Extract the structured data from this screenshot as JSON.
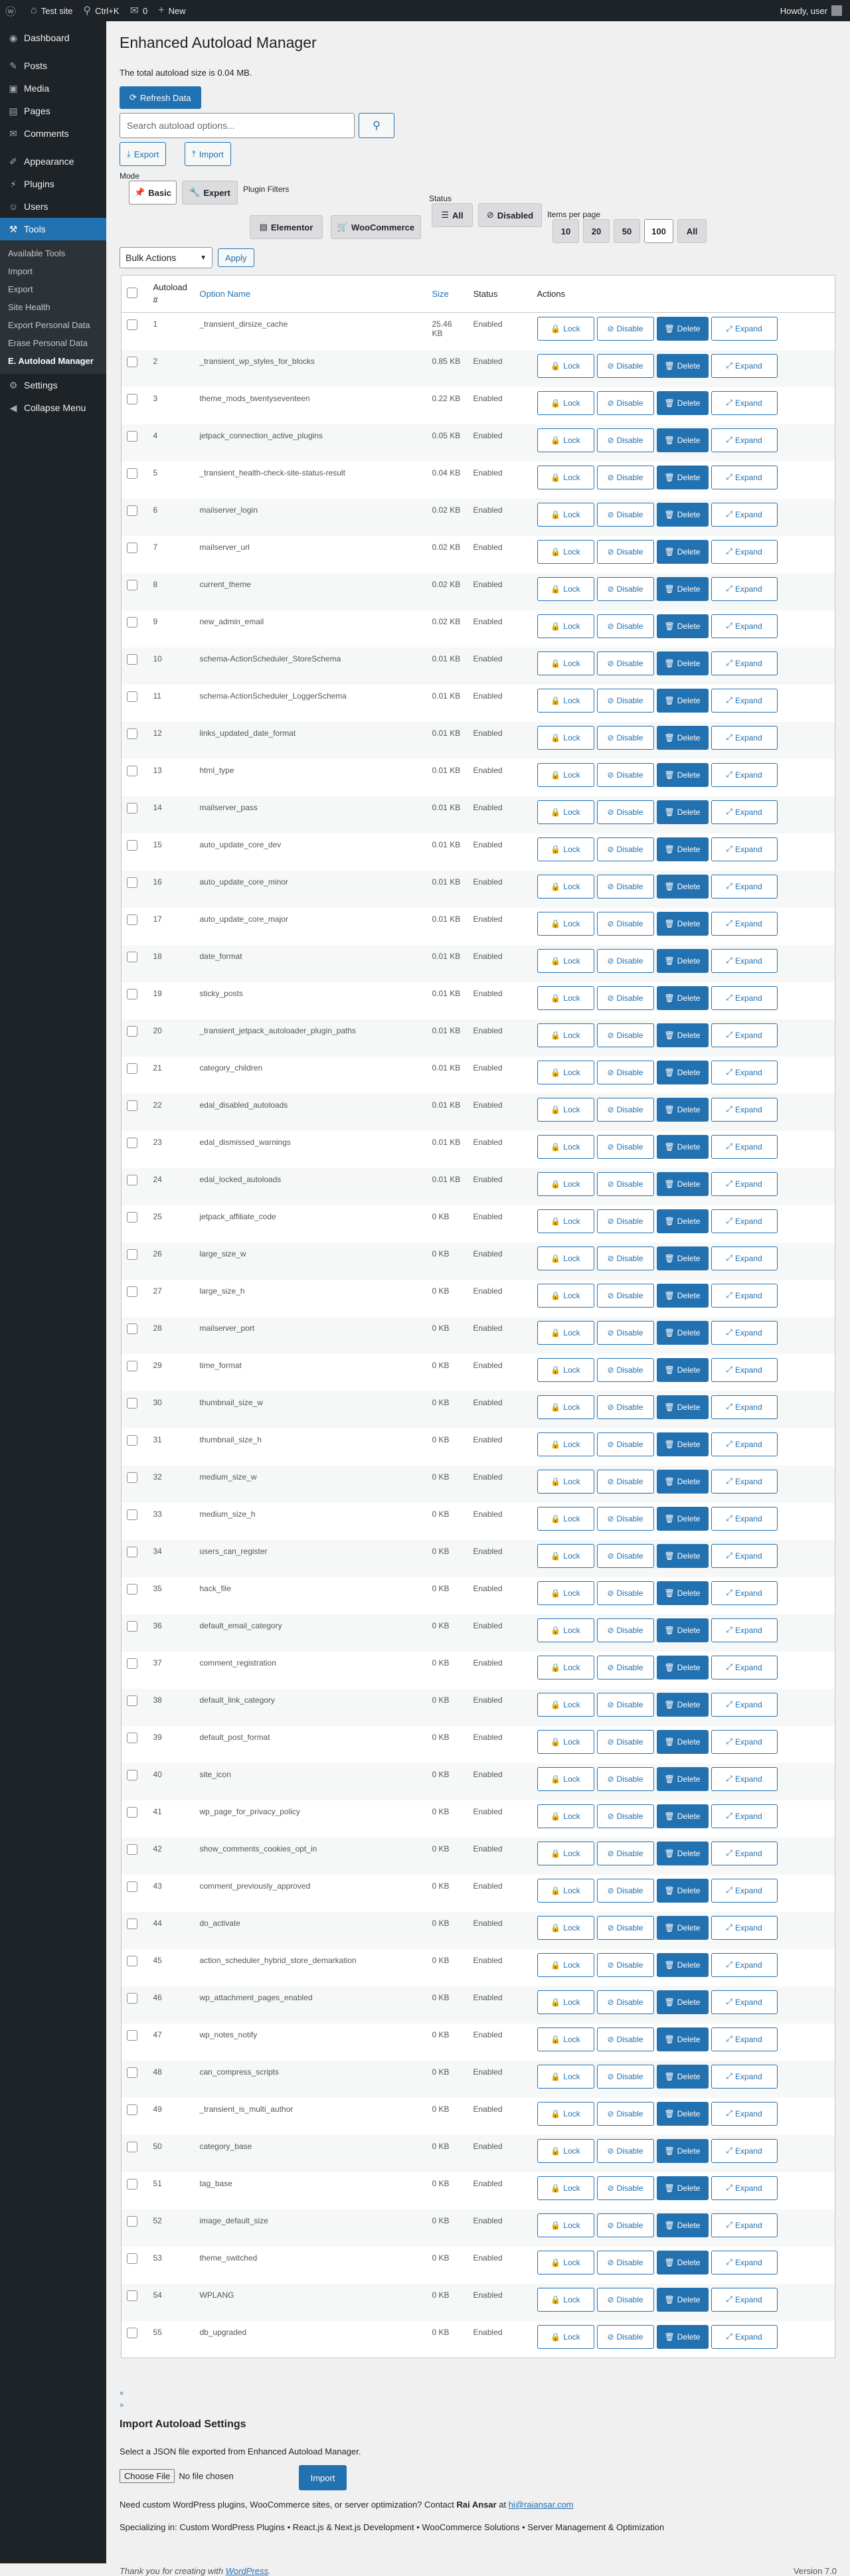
{
  "adminbar": {
    "site": "Test site",
    "search": "Ctrl+K",
    "comments": "0",
    "new": "New",
    "howdy": "Howdy, user"
  },
  "sidebar": {
    "items": [
      {
        "label": "Dashboard",
        "icon": "dashboard-icon"
      },
      {
        "label": "Posts",
        "icon": "pin-icon"
      },
      {
        "label": "Media",
        "icon": "media-icon"
      },
      {
        "label": "Pages",
        "icon": "page-icon"
      },
      {
        "label": "Comments",
        "icon": "comment-icon"
      },
      {
        "label": "Appearance",
        "icon": "brush-icon"
      },
      {
        "label": "Plugins",
        "icon": "plugin-icon"
      },
      {
        "label": "Users",
        "icon": "user-icon"
      },
      {
        "label": "Tools",
        "icon": "wrench-icon"
      }
    ],
    "submenu": [
      "Available Tools",
      "Import",
      "Export",
      "Site Health",
      "Export Personal Data",
      "Erase Personal Data",
      "E. Autoload Manager"
    ],
    "settings": "Settings",
    "collapse": "Collapse Menu"
  },
  "page": {
    "title": "Enhanced Autoload Manager",
    "total": "The total autoload size is 0.04 MB.",
    "refresh": "Refresh Data",
    "search_placeholder": "Search autoload options...",
    "export": "Export",
    "import": "Import"
  },
  "filters": {
    "mode_label": "Mode",
    "mode": [
      "Basic",
      "Expert"
    ],
    "plugin_label": "Plugin Filters",
    "plugins": [
      "Elementor",
      "WooCommerce"
    ],
    "status_label": "Status",
    "status": [
      "All",
      "Disabled"
    ],
    "perpage_label": "Items per page",
    "perpage": [
      "10",
      "20",
      "50",
      "100",
      "All"
    ]
  },
  "bulk": {
    "label": "Bulk Actions",
    "apply": "Apply"
  },
  "table": {
    "headers": {
      "num": "Autoload #",
      "name": "Option Name",
      "size": "Size",
      "status": "Status",
      "actions": "Actions"
    },
    "action_labels": {
      "lock": "Lock",
      "disable": "Disable",
      "delete": "Delete",
      "expand": "Expand"
    },
    "rows": [
      {
        "num": "1",
        "name": "_transient_dirsize_cache",
        "size": "25.46 KB",
        "status": "Enabled"
      },
      {
        "num": "2",
        "name": "_transient_wp_styles_for_blocks",
        "size": "0.85 KB",
        "status": "Enabled"
      },
      {
        "num": "3",
        "name": "theme_mods_twentyseventeen",
        "size": "0.22 KB",
        "status": "Enabled"
      },
      {
        "num": "4",
        "name": "jetpack_connection_active_plugins",
        "size": "0.05 KB",
        "status": "Enabled"
      },
      {
        "num": "5",
        "name": "_transient_health-check-site-status-result",
        "size": "0.04 KB",
        "status": "Enabled"
      },
      {
        "num": "6",
        "name": "mailserver_login",
        "size": "0.02 KB",
        "status": "Enabled"
      },
      {
        "num": "7",
        "name": "mailserver_url",
        "size": "0.02 KB",
        "status": "Enabled"
      },
      {
        "num": "8",
        "name": "current_theme",
        "size": "0.02 KB",
        "status": "Enabled"
      },
      {
        "num": "9",
        "name": "new_admin_email",
        "size": "0.02 KB",
        "status": "Enabled"
      },
      {
        "num": "10",
        "name": "schema-ActionScheduler_StoreSchema",
        "size": "0.01 KB",
        "status": "Enabled"
      },
      {
        "num": "11",
        "name": "schema-ActionScheduler_LoggerSchema",
        "size": "0.01 KB",
        "status": "Enabled"
      },
      {
        "num": "12",
        "name": "links_updated_date_format",
        "size": "0.01 KB",
        "status": "Enabled"
      },
      {
        "num": "13",
        "name": "html_type",
        "size": "0.01 KB",
        "status": "Enabled"
      },
      {
        "num": "14",
        "name": "mailserver_pass",
        "size": "0.01 KB",
        "status": "Enabled"
      },
      {
        "num": "15",
        "name": "auto_update_core_dev",
        "size": "0.01 KB",
        "status": "Enabled"
      },
      {
        "num": "16",
        "name": "auto_update_core_minor",
        "size": "0.01 KB",
        "status": "Enabled"
      },
      {
        "num": "17",
        "name": "auto_update_core_major",
        "size": "0.01 KB",
        "status": "Enabled"
      },
      {
        "num": "18",
        "name": "date_format",
        "size": "0.01 KB",
        "status": "Enabled"
      },
      {
        "num": "19",
        "name": "sticky_posts",
        "size": "0.01 KB",
        "status": "Enabled"
      },
      {
        "num": "20",
        "name": "_transient_jetpack_autoloader_plugin_paths",
        "size": "0.01 KB",
        "status": "Enabled"
      },
      {
        "num": "21",
        "name": "category_children",
        "size": "0.01 KB",
        "status": "Enabled"
      },
      {
        "num": "22",
        "name": "edal_disabled_autoloads",
        "size": "0.01 KB",
        "status": "Enabled"
      },
      {
        "num": "23",
        "name": "edal_dismissed_warnings",
        "size": "0.01 KB",
        "status": "Enabled"
      },
      {
        "num": "24",
        "name": "edal_locked_autoloads",
        "size": "0.01 KB",
        "status": "Enabled"
      },
      {
        "num": "25",
        "name": "jetpack_affiliate_code",
        "size": "0 KB",
        "status": "Enabled"
      },
      {
        "num": "26",
        "name": "large_size_w",
        "size": "0 KB",
        "status": "Enabled"
      },
      {
        "num": "27",
        "name": "large_size_h",
        "size": "0 KB",
        "status": "Enabled"
      },
      {
        "num": "28",
        "name": "mailserver_port",
        "size": "0 KB",
        "status": "Enabled"
      },
      {
        "num": "29",
        "name": "time_format",
        "size": "0 KB",
        "status": "Enabled"
      },
      {
        "num": "30",
        "name": "thumbnail_size_w",
        "size": "0 KB",
        "status": "Enabled"
      },
      {
        "num": "31",
        "name": "thumbnail_size_h",
        "size": "0 KB",
        "status": "Enabled"
      },
      {
        "num": "32",
        "name": "medium_size_w",
        "size": "0 KB",
        "status": "Enabled"
      },
      {
        "num": "33",
        "name": "medium_size_h",
        "size": "0 KB",
        "status": "Enabled"
      },
      {
        "num": "34",
        "name": "users_can_register",
        "size": "0 KB",
        "status": "Enabled"
      },
      {
        "num": "35",
        "name": "hack_file",
        "size": "0 KB",
        "status": "Enabled"
      },
      {
        "num": "36",
        "name": "default_email_category",
        "size": "0 KB",
        "status": "Enabled"
      },
      {
        "num": "37",
        "name": "comment_registration",
        "size": "0 KB",
        "status": "Enabled"
      },
      {
        "num": "38",
        "name": "default_link_category",
        "size": "0 KB",
        "status": "Enabled"
      },
      {
        "num": "39",
        "name": "default_post_format",
        "size": "0 KB",
        "status": "Enabled"
      },
      {
        "num": "40",
        "name": "site_icon",
        "size": "0 KB",
        "status": "Enabled"
      },
      {
        "num": "41",
        "name": "wp_page_for_privacy_policy",
        "size": "0 KB",
        "status": "Enabled"
      },
      {
        "num": "42",
        "name": "show_comments_cookies_opt_in",
        "size": "0 KB",
        "status": "Enabled"
      },
      {
        "num": "43",
        "name": "comment_previously_approved",
        "size": "0 KB",
        "status": "Enabled"
      },
      {
        "num": "44",
        "name": "do_activate",
        "size": "0 KB",
        "status": "Enabled"
      },
      {
        "num": "45",
        "name": "action_scheduler_hybrid_store_demarkation",
        "size": "0 KB",
        "status": "Enabled"
      },
      {
        "num": "46",
        "name": "wp_attachment_pages_enabled",
        "size": "0 KB",
        "status": "Enabled"
      },
      {
        "num": "47",
        "name": "wp_notes_notify",
        "size": "0 KB",
        "status": "Enabled"
      },
      {
        "num": "48",
        "name": "can_compress_scripts",
        "size": "0 KB",
        "status": "Enabled"
      },
      {
        "num": "49",
        "name": "_transient_is_multi_author",
        "size": "0 KB",
        "status": "Enabled"
      },
      {
        "num": "50",
        "name": "category_base",
        "size": "0 KB",
        "status": "Enabled"
      },
      {
        "num": "51",
        "name": "tag_base",
        "size": "0 KB",
        "status": "Enabled"
      },
      {
        "num": "52",
        "name": "image_default_size",
        "size": "0 KB",
        "status": "Enabled"
      },
      {
        "num": "53",
        "name": "theme_switched",
        "size": "0 KB",
        "status": "Enabled"
      },
      {
        "num": "54",
        "name": "WPLANG",
        "size": "0 KB",
        "status": "Enabled"
      },
      {
        "num": "55",
        "name": "db_upgraded",
        "size": "0 KB",
        "status": "Enabled"
      }
    ]
  },
  "pagination": {
    "prev": "«",
    "next": "»"
  },
  "import_section": {
    "title": "Import Autoload Settings",
    "desc": "Select a JSON file exported from Enhanced Autoload Manager.",
    "choose": "Choose File",
    "nofile": "No file chosen",
    "button": "Import"
  },
  "contact": {
    "pre": "Need custom WordPress plugins, WooCommerce sites, or server optimization? Contact",
    "name": "Rai Ansar",
    "at": "at",
    "email": "hi@raiansar.com"
  },
  "specializing": "Specializing in: Custom WordPress Plugins • React.js & Next.js Development • WooCommerce Solutions • Server Management & Optimization",
  "footer": {
    "thanks": "Thank you for creating with",
    "wp": "WordPress",
    "version": "Version 7.0"
  },
  "colors": {
    "accent": "#2271b1",
    "sidebar": "#1d2327",
    "background": "#f0f0f1"
  }
}
